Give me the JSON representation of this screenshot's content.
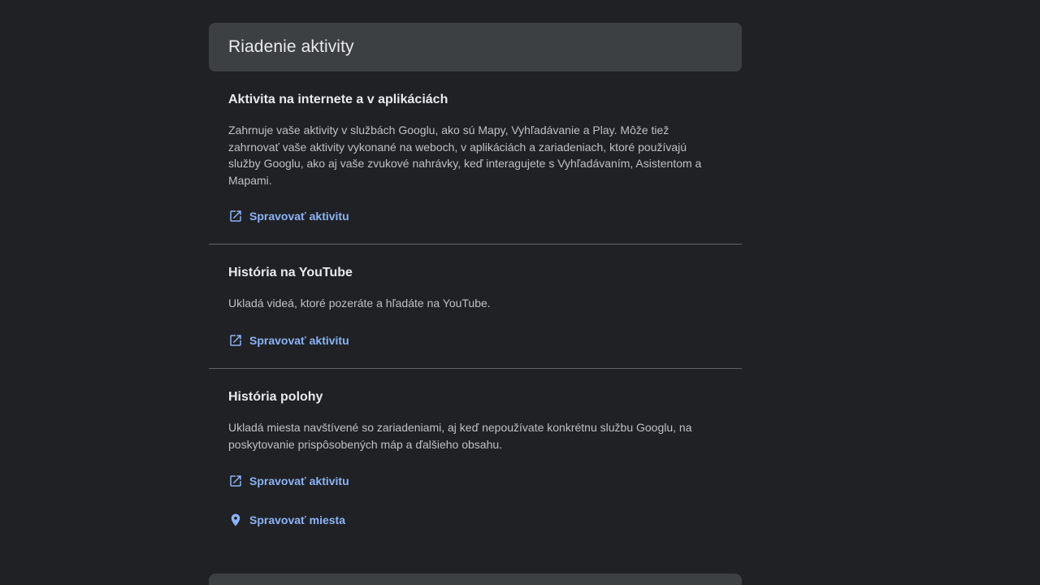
{
  "header": {
    "title": "Riadenie aktivity"
  },
  "sections": [
    {
      "title": "Aktivita na internete a v aplikáciách",
      "description": "Zahrnuje vaše aktivity v službách Googlu, ako sú Mapy, Vyhľadávanie a Play. Môže tiež zahrnovať vaše aktivity vykonané na weboch, v aplikáciách a zariadeniach, ktoré používajú služby Googlu, ako aj vaše zvukové nahrávky, keď interagujete s Vyhľadávaním, Asistentom a Mapami.",
      "links": [
        {
          "label": "Spravovať aktivitu",
          "icon": "open-in-new-icon"
        }
      ]
    },
    {
      "title": "História na YouTube",
      "description": "Ukladá videá, ktoré pozeráte a hľadáte na YouTube.",
      "links": [
        {
          "label": "Spravovať aktivitu",
          "icon": "open-in-new-icon"
        }
      ]
    },
    {
      "title": "História polohy",
      "description": "Ukladá miesta navštívené so zariadeniami, aj keď nepoužívate konkrétnu službu Googlu, na poskytovanie prispôsobených máp a ďalšieho obsahu.",
      "links": [
        {
          "label": "Spravovať aktivitu",
          "icon": "open-in-new-icon"
        },
        {
          "label": "Spravovať miesta",
          "icon": "location-pin-icon"
        }
      ]
    }
  ],
  "colors": {
    "background": "#202124",
    "header_background": "#3c4043",
    "link": "#8ab4f8",
    "divider": "#5f6368"
  }
}
